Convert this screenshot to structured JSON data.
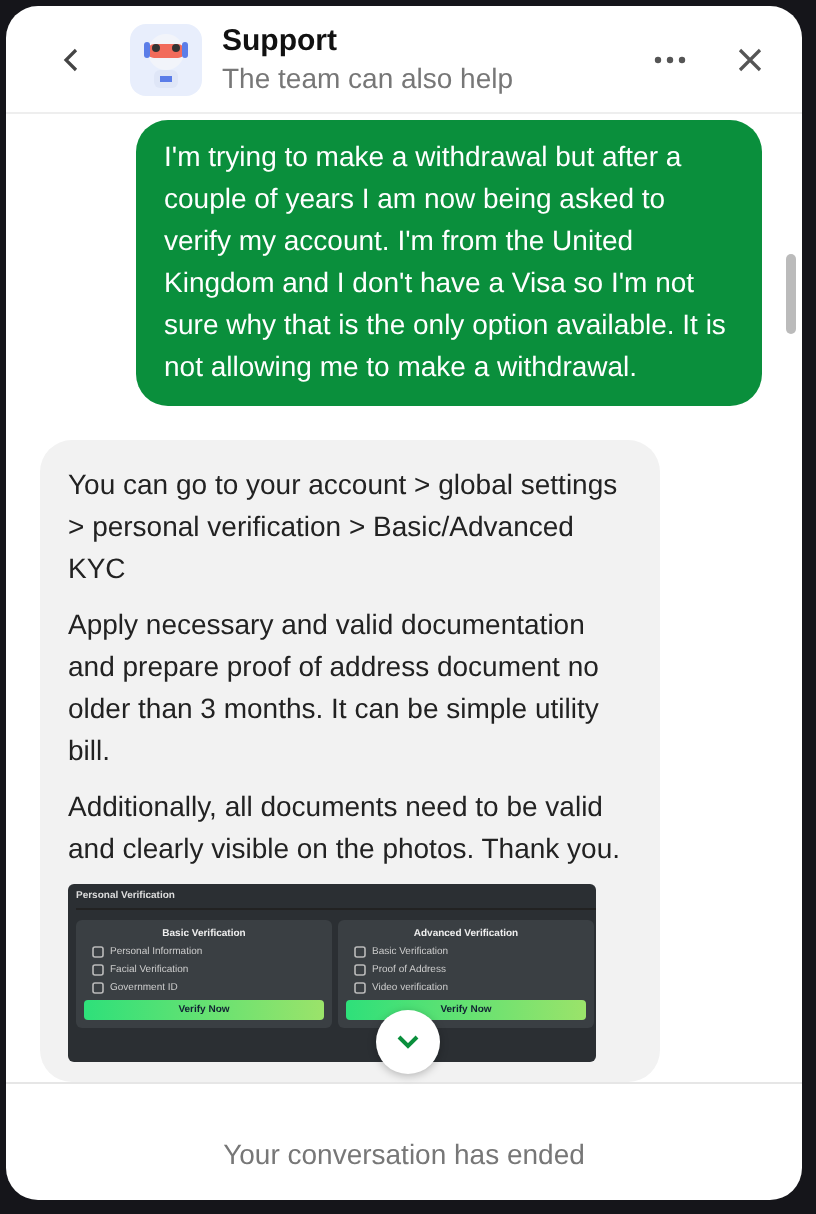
{
  "header": {
    "title": "Support",
    "subtitle": "The team can also help"
  },
  "messages": [
    {
      "kind": "user",
      "paragraphs": [
        "I'm trying to make a withdrawal but after a couple of years I am now being asked to verify my account. I'm from the United Kingdom and I don't have a Visa so I'm not sure why that is the only option available. It is not allowing me to make a withdrawal."
      ]
    },
    {
      "kind": "agent",
      "paragraphs": [
        "You can go to your account > global settings > personal verification > Basic/Advanced KYC",
        "Apply necessary and valid documentation and prepare proof of address document no older than 3 months. It can be simple utility bill.",
        "Additionally, all documents need to be valid and clearly visible on the photos. Thank you."
      ],
      "attachment": {
        "title": "Personal Verification",
        "panels": [
          {
            "title": "Basic Verification",
            "items": [
              "Personal Information",
              "Facial Verification",
              "Government ID"
            ],
            "button": "Verify Now"
          },
          {
            "title": "Advanced Verification",
            "items": [
              "Basic Verification",
              "Proof of Address",
              "Video verification"
            ],
            "button": "Verify Now"
          }
        ]
      }
    }
  ],
  "footer": {
    "status": "Your conversation has ended"
  }
}
